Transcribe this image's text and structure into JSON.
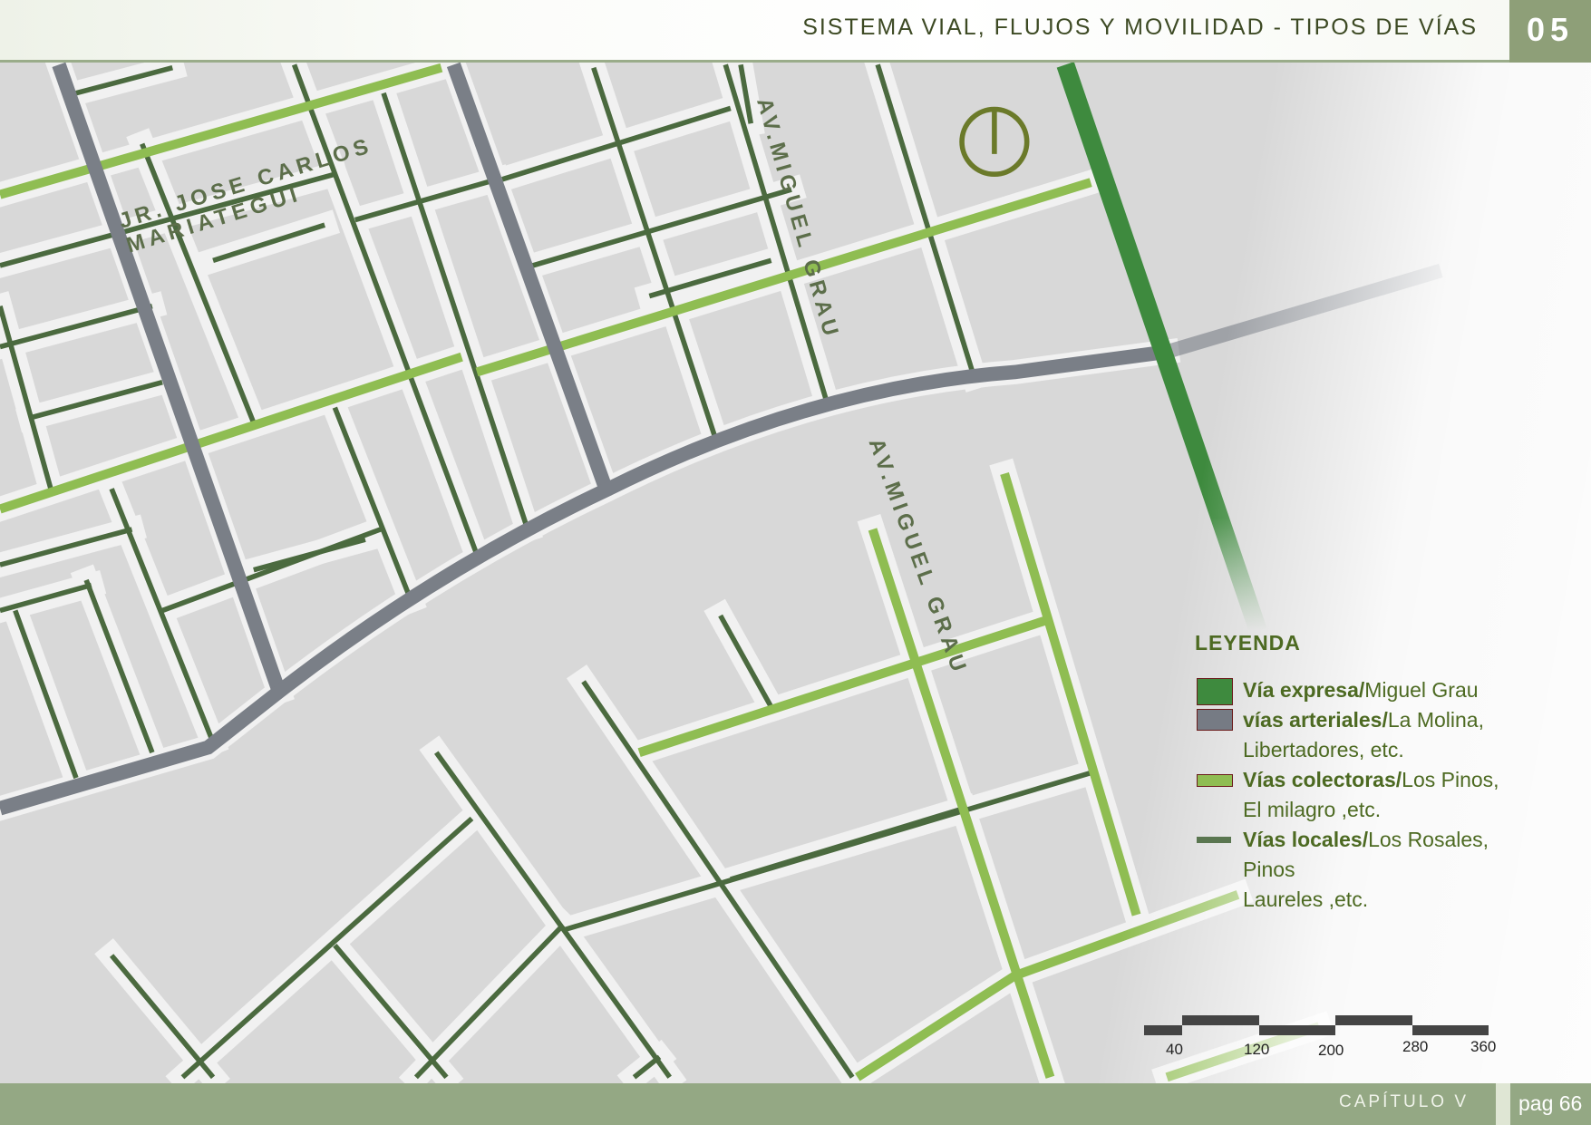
{
  "header": {
    "title": "SISTEMA VIAL, FLUJOS Y MOVILIDAD - TIPOS DE VÍAS",
    "chapter_number": "05"
  },
  "footer": {
    "chapter": "CAPÍTULO V",
    "page": "pag 66"
  },
  "map": {
    "street_labels": {
      "mariategui_line1": "JR. JOSE CARLOS",
      "mariategui_line2": "MARIATEGUI",
      "grau_north": "AV.MIGUEL GRAU",
      "grau_south": "AV.MIGUEL GRAU"
    },
    "colors": {
      "expresa": "#3e8a3e",
      "arterial": "#7a7f87",
      "colectora": "#8fbd52",
      "local": "#4b6a3f"
    },
    "north_icon": "north-arrow-icon"
  },
  "legend": {
    "title": "LEYENDA",
    "items": [
      {
        "bold": "Vía expresa/",
        "text": "Miguel Grau",
        "extra": ""
      },
      {
        "bold": "vías arteriales/",
        "text": "La Molina,",
        "extra": "Libertadores, etc."
      },
      {
        "bold": "Vías colectoras/",
        "text": "Los Pinos,",
        "extra": "El milagro ,etc."
      },
      {
        "bold": "Vías  locales/",
        "text": "Los  Rosales,",
        "extra": "Pinos",
        "extra2": "Laureles ,etc."
      }
    ]
  },
  "scale_bar": {
    "labels": [
      "40",
      "120",
      "200",
      "280",
      "360"
    ]
  }
}
